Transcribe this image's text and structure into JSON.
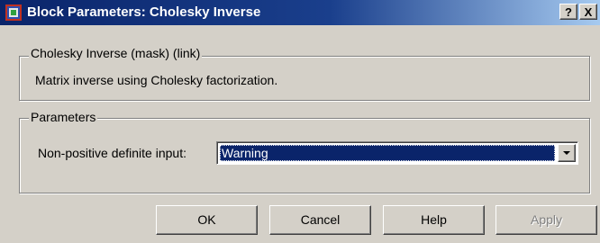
{
  "window": {
    "title": "Block Parameters: Cholesky Inverse",
    "help_glyph": "?",
    "close_glyph": "X"
  },
  "description_group": {
    "legend": "Cholesky Inverse (mask) (link)",
    "text": "Matrix inverse using Cholesky factorization."
  },
  "parameters_group": {
    "legend": "Parameters",
    "field_label": "Non-positive definite input:",
    "field_value": "Warning"
  },
  "buttons": {
    "ok": "OK",
    "cancel": "Cancel",
    "help": "Help",
    "apply": "Apply"
  }
}
